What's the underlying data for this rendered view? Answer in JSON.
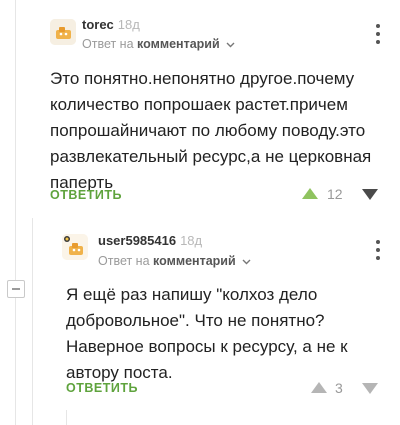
{
  "comments": [
    {
      "username": "torec",
      "age": "18д",
      "reply_prefix": "Ответ на",
      "reply_target": "комментарий",
      "text": "Это понятно.непонятно другое.почему количество попрошаек растет.причем попрошайничают по любому поводу.это развлекательный ресурс,а не церковная паперть",
      "reply_label": "ОТВЕТИТЬ",
      "rating": "12"
    },
    {
      "username": "user5985416",
      "age": "18д",
      "reply_prefix": "Ответ на",
      "reply_target": "комментарий",
      "text": "Я ещё раз напишу \"колхоз дело добровольное\". Что не понятно? Наверное вопросы к ресурсу, а не к автору поста.",
      "reply_label": "ОТВЕТИТЬ",
      "rating": "3"
    }
  ],
  "colors": {
    "accent_green": "#5fa33d",
    "upvote_green": "#8fc35f",
    "muted_gray": "#9a9a9a"
  },
  "icons": [
    "avatar-icon",
    "chevron-down-icon",
    "more-options-icon",
    "upvote-icon",
    "downvote-icon",
    "collapse-icon"
  ]
}
